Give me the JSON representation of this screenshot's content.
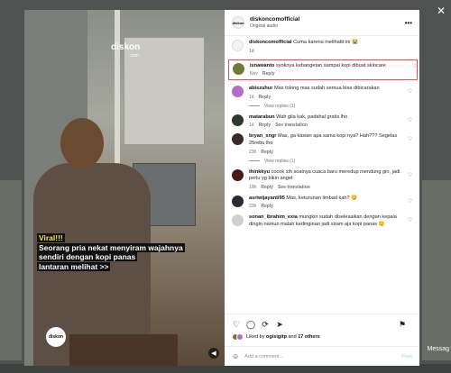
{
  "overlay": {
    "close_icon": "close-icon",
    "background_message": "Messag"
  },
  "media": {
    "brand_name": "diskon",
    "brand_sub": ".com",
    "caption_line1": "Viral!!!",
    "caption_line2": "Seorang pria nekat menyiram wajahnya",
    "caption_line3": "sendiri dengan kopi panas",
    "caption_line4": "lantaran melihat >>",
    "badge_text": "diskon",
    "audio_icon": "speaker-muted-icon"
  },
  "header": {
    "username": "diskoncomofficial",
    "audio": "Original audio",
    "avatar_text": "diskon",
    "more_icon": "more-icon"
  },
  "comments": [
    {
      "user": "diskoncomofficial",
      "text": "Cuma karena melihattt ini 😭",
      "time": "1d",
      "reply": "",
      "likes": "",
      "translation": "",
      "view_replies": "",
      "color": "#f2f2f2"
    },
    {
      "user": "isnawanto",
      "text": "syoknya kebangetan sampai kopi dibuat skincare",
      "time": "Nov",
      "reply": "Reply",
      "likes": "",
      "translation": "",
      "view_replies": "",
      "color": "#6e7a3a",
      "highlighted": true
    },
    {
      "user": "abiszuhur",
      "text": "Mas tolong mas sudah semua bisa dibicarakan",
      "time": "1d",
      "reply": "Reply",
      "likes": "",
      "translation": "",
      "view_replies": "View replies (1)",
      "color": "#b86ac9"
    },
    {
      "user": "matarabun",
      "text": "Wah gila kak, padahal gratis lho",
      "time": "1d",
      "reply": "Reply",
      "likes": "",
      "translation": "See translation",
      "view_replies": "",
      "color": "#2c3a2f"
    },
    {
      "user": "bryan_sngr",
      "text": "Mas, ga kasian apa sama kopi nya? Hah??? Segelas 25rebu lho",
      "time": "23h",
      "reply": "Reply",
      "likes": "",
      "translation": "",
      "view_replies": "View replies (1)",
      "color": "#3a2a2a"
    },
    {
      "user": "thinkkyu",
      "text": "cocok sih soalnya cuaca baru meredup mendung giri, jadi perlu yg bikin anget",
      "time": "19h",
      "reply": "Reply",
      "likes": "",
      "translation": "See translation",
      "view_replies": "",
      "color": "#4a1a1a"
    },
    {
      "user": "asriwijayanti95",
      "text": "Mas, keturunan limbad kah? 😏",
      "time": "23h",
      "reply": "Reply",
      "likes": "",
      "translation": "",
      "view_replies": "",
      "color": "#2a2a35"
    },
    {
      "user": "sonan_ibrahim_exia",
      "text": "mungkin sudah diselesaikan dengan kepala dingin namun malah kedinginan jadi siram aja kopi panas 😌",
      "time": "",
      "reply": "",
      "likes": "",
      "translation": "",
      "view_replies": "",
      "color": "#d0d0d0"
    }
  ],
  "actions": {
    "like_icon": "heart-icon",
    "comment_icon": "comment-icon",
    "share_icon": "share-icon",
    "send_icon": "send-icon",
    "save_icon": "bookmark-icon"
  },
  "likes": {
    "liked_by": "Liked by",
    "user": "ogisigitp",
    "and": "and",
    "others": "17 others",
    "date": ""
  },
  "add_comment": {
    "placeholder": "Add a comment...",
    "post": "Post",
    "emoji_icon": "emoji-icon"
  }
}
